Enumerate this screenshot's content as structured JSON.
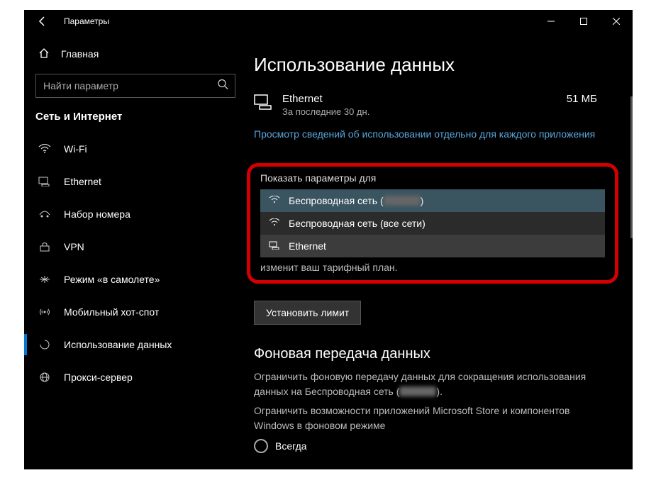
{
  "titlebar": {
    "title": "Параметры"
  },
  "sidebar": {
    "home": "Главная",
    "search_placeholder": "Найти параметр",
    "section": "Сеть и Интернет",
    "items": [
      {
        "label": "Wi-Fi"
      },
      {
        "label": "Ethernet"
      },
      {
        "label": "Набор номера"
      },
      {
        "label": "VPN"
      },
      {
        "label": "Режим «в самолете»"
      },
      {
        "label": "Мобильный хот-спот"
      },
      {
        "label": "Использование данных"
      },
      {
        "label": "Прокси-сервер"
      }
    ]
  },
  "content": {
    "heading": "Использование данных",
    "usage": {
      "name": "Ethernet",
      "sub": "За последние 30 дн.",
      "value": "51 МБ"
    },
    "view_link": "Просмотр сведений об использовании отдельно для каждого приложения",
    "dropdown": {
      "label": "Показать параметры для",
      "opt1_prefix": "Беспроводная сеть (",
      "opt1_suffix": ")",
      "opt2": "Беспроводная сеть (все сети)",
      "opt3": "Ethernet"
    },
    "after_dd": "изменит ваш тарифный план.",
    "button": "Установить лимит",
    "bg_heading": "Фоновая передача данных",
    "bg_desc1_prefix": "Ограничить фоновую передачу данных для сокращения использования данных на Беспроводная сеть (",
    "bg_desc1_suffix": ").",
    "bg_desc2": "Ограничить возможности приложений Microsoft Store и компонентов Windows в фоновом режиме",
    "radio_always": "Всегда"
  }
}
